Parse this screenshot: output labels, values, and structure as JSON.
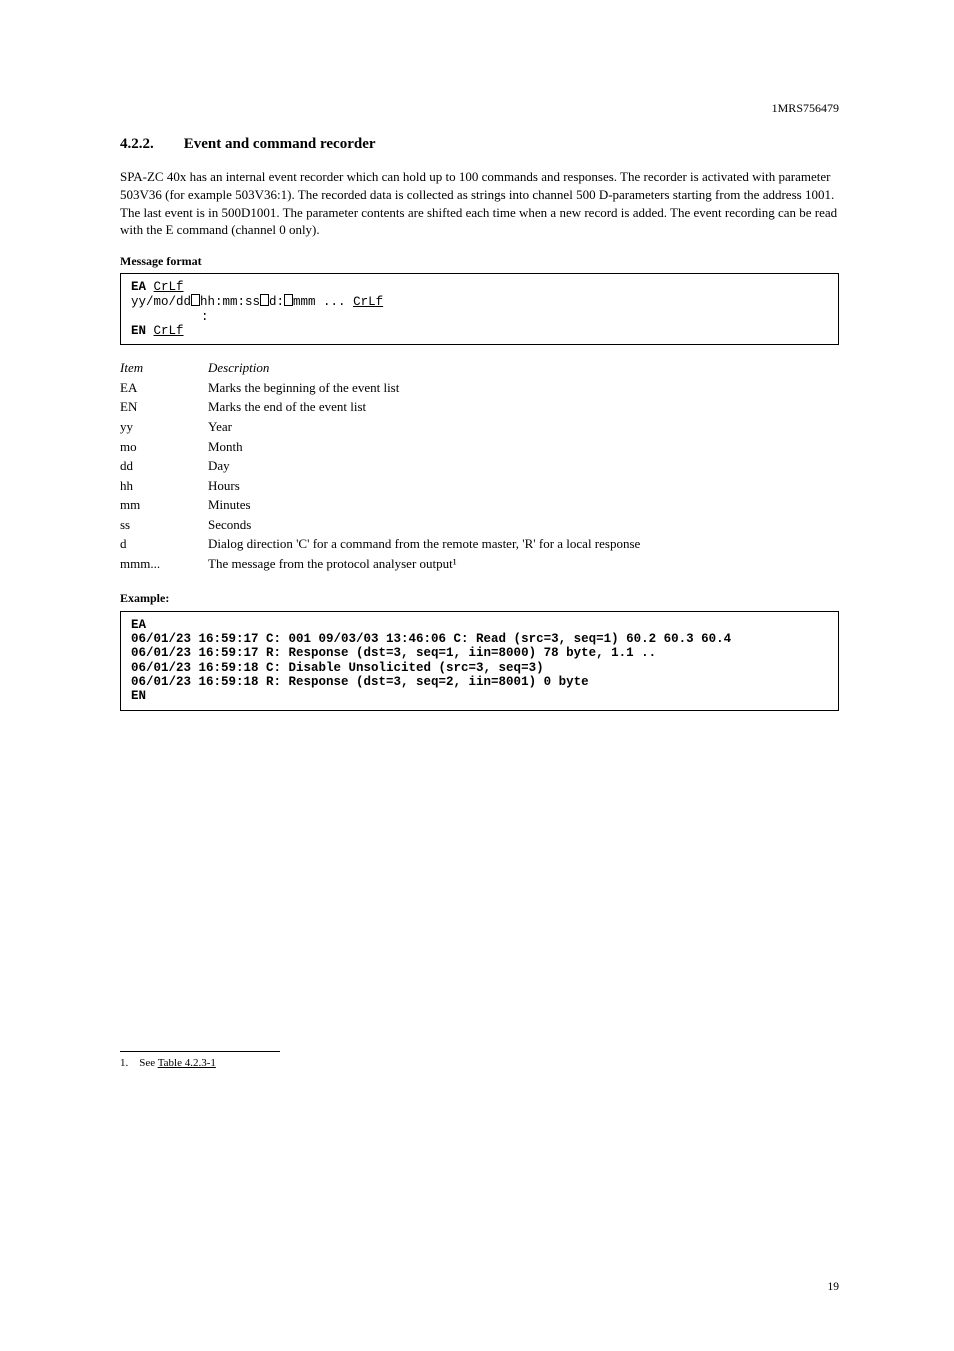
{
  "docId": "1MRS756479",
  "sectionNumber": "4.2.2.",
  "sectionTitle": "Event and command recorder",
  "intro": "SPA-ZC 40x has an internal event recorder which can hold up to 100 commands and responses. The recorder is activated with parameter 503V36 (for example 503V36:1). The recorded data is collected as strings into channel 500 D-parameters starting from the address 1001. The last event is in 500D1001. The parameter contents are shifted each time when a new record is added. The event recording can be read with the E command (channel 0 only).",
  "messageFormatLabel": "Message format",
  "codebox1": {
    "ea": "EA",
    "crlf": "CrLf",
    "fmt_pre": "yy/mo/dd",
    "fmt_mid1": "hh:mm:ss",
    "fmt_d": "d:",
    "fmt_mmm": "mmm ...",
    "crlf2": "CrLf",
    "colon": ":",
    "en": "EN",
    "crlf3": "CrLf"
  },
  "tableHeader": {
    "col1": "Item",
    "col2": "Description"
  },
  "rows": [
    {
      "item": "EA",
      "desc": "Marks the beginning of the event list"
    },
    {
      "item": "EN",
      "desc": "Marks the end of the event list"
    },
    {
      "item": "yy",
      "desc": "Year"
    },
    {
      "item": "mo",
      "desc": "Month"
    },
    {
      "item": "dd",
      "desc": "Day"
    },
    {
      "item": "hh",
      "desc": "Hours"
    },
    {
      "item": "mm",
      "desc": "Minutes"
    },
    {
      "item": "ss",
      "desc": "Seconds"
    },
    {
      "item": "d",
      "desc": "Dialog direction 'C' for a command from the remote master, 'R' for a local response"
    },
    {
      "item": "mmm...",
      "desc": "The message from the protocol analyser output¹"
    }
  ],
  "exampleLabel": "Example:",
  "codebox2": [
    "EA",
    "06/01/23 16:59:17 C: 001 09/03/03 13:46:06 C: Read (src=3, seq=1) 60.2 60.3 60.4",
    "06/01/23 16:59:17 R: Response (dst=3, seq=1, iin=8000) 78 byte, 1.1 ..",
    "06/01/23 16:59:18 C: Disable Unsolicited (src=3, seq=3)",
    "06/01/23 16:59:18 R: Response (dst=3, seq=2, iin=8001) 0 byte",
    "EN"
  ],
  "footnote": {
    "marker": "1.",
    "text": "See ",
    "link": "Table 4.2.3-1"
  },
  "footer": {
    "left": "",
    "right": "19"
  }
}
